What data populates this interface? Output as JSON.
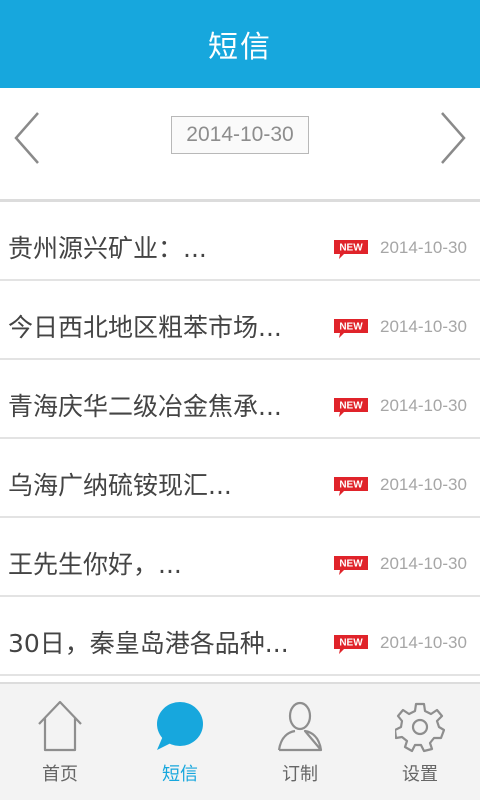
{
  "header": {
    "title": "短信"
  },
  "date_nav": {
    "current_date": "2014-10-30",
    "prev_icon": "chevron-left-icon",
    "next_icon": "chevron-right-icon"
  },
  "messages": [
    {
      "text": "贵州源兴矿业：...",
      "badge": "NEW",
      "date": "2014-10-30"
    },
    {
      "text": "今日西北地区粗苯市场...",
      "badge": "NEW",
      "date": "2014-10-30"
    },
    {
      "text": "青海庆华二级冶金焦承...",
      "badge": "NEW",
      "date": "2014-10-30"
    },
    {
      "text": "乌海广纳硫铵现汇...",
      "badge": "NEW",
      "date": "2014-10-30"
    },
    {
      "text": "王先生你好，...",
      "badge": "NEW",
      "date": "2014-10-30"
    },
    {
      "text": "30日，秦皇岛港各品种...",
      "badge": "NEW",
      "date": "2014-10-30"
    }
  ],
  "tabbar": {
    "tabs": [
      {
        "label": "首页",
        "icon": "home-icon",
        "active": false
      },
      {
        "label": "短信",
        "icon": "speech-bubble-icon",
        "active": true
      },
      {
        "label": "订制",
        "icon": "person-icon",
        "active": false
      },
      {
        "label": "设置",
        "icon": "gear-icon",
        "active": false
      }
    ]
  },
  "colors": {
    "accent": "#17a7dd",
    "badge_red": "#e0232a",
    "text": "#444444",
    "muted": "#a6a6a6"
  }
}
